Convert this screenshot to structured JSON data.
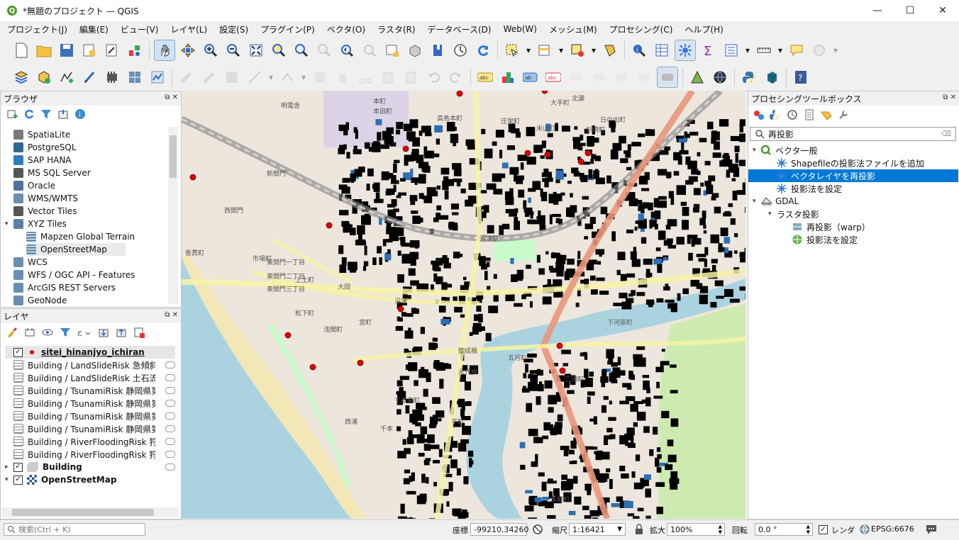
{
  "window": {
    "title": "*無題のプロジェクト — QGIS",
    "app_letter": "Q"
  },
  "menu": [
    "プロジェクト(J)",
    "編集(E)",
    "ビュー(V)",
    "レイヤ(L)",
    "設定(S)",
    "プラグイン(P)",
    "ベクタ(O)",
    "ラスタ(R)",
    "データベース(D)",
    "Web(W)",
    "メッシュ(M)",
    "プロセシング(C)",
    "ヘルプ(H)"
  ],
  "browser": {
    "title": "ブラウザ",
    "items": [
      {
        "label": "SpatiaLite",
        "icon": "spatialite-icon",
        "color": "#7a7a7a",
        "level": 0
      },
      {
        "label": "PostgreSQL",
        "icon": "postgresql-icon",
        "color": "#336791",
        "level": 0
      },
      {
        "label": "SAP HANA",
        "icon": "sap-hana-icon",
        "color": "#2b7bbf",
        "level": 0
      },
      {
        "label": "MS SQL Server",
        "icon": "mssql-icon",
        "color": "#555555",
        "level": 0
      },
      {
        "label": "Oracle",
        "icon": "oracle-icon",
        "color": "#4f6f9f",
        "level": 0
      },
      {
        "label": "WMS/WMTS",
        "icon": "wms-icon",
        "color": "#6a8fb3",
        "level": 0
      },
      {
        "label": "Vector Tiles",
        "icon": "vector-tiles-icon",
        "color": "#555555",
        "level": 0
      },
      {
        "label": "XYZ Tiles",
        "icon": "xyz-tiles-icon",
        "color": "#5b7fa5",
        "level": 0
      },
      {
        "label": "Mapzen Global Terrain",
        "icon": "grid-icon",
        "color": "#6a8fb3",
        "level": 1
      },
      {
        "label": "OpenStreetMap",
        "icon": "grid-icon",
        "color": "#6a8fb3",
        "level": 1
      },
      {
        "label": "WCS",
        "icon": "wcs-icon",
        "color": "#6a8fb3",
        "level": 0
      },
      {
        "label": "WFS / OGC API - Features",
        "icon": "wfs-icon",
        "color": "#6a8fb3",
        "level": 0
      },
      {
        "label": "ArcGIS REST Servers",
        "icon": "arcgis-icon",
        "color": "#6a8fb3",
        "level": 0
      },
      {
        "label": "GeoNode",
        "icon": "geonode-icon",
        "color": "#6a8fb3",
        "level": 0
      }
    ]
  },
  "layers": {
    "title": "レイヤ",
    "items": [
      {
        "label": "sitei_hinanjyo_ichiran",
        "checked": true,
        "icon": "point-layer-icon",
        "bold": true,
        "underline": true
      },
      {
        "label": "Building / LandSlideRisk 急傾斜地",
        "checked": null,
        "icon": "table-icon"
      },
      {
        "label": "Building / LandSlideRisk 土石流",
        "checked": null,
        "icon": "table-icon"
      },
      {
        "label": "Building / TsunamiRisk 静岡県第４",
        "checked": null,
        "icon": "table-icon"
      },
      {
        "label": "Building / TsunamiRisk 静岡県第４",
        "checked": null,
        "icon": "table-icon"
      },
      {
        "label": "Building / TsunamiRisk 静岡県第４",
        "checked": null,
        "icon": "table-icon"
      },
      {
        "label": "Building / TsunamiRisk 静岡県第４",
        "checked": null,
        "icon": "table-icon"
      },
      {
        "label": "Building / RiverFloodingRisk 狩野川",
        "checked": null,
        "icon": "table-icon"
      },
      {
        "label": "Building / RiverFloodingRisk 狩野川",
        "checked": null,
        "icon": "table-icon"
      },
      {
        "label": "Building",
        "checked": true,
        "icon": "polygon-layer-icon",
        "bold": true
      },
      {
        "label": "OpenStreetMap",
        "checked": true,
        "icon": "raster-layer-icon",
        "bold": true
      }
    ]
  },
  "toolbox": {
    "title": "プロセシングツールボックス",
    "search_value": "再投影",
    "items": [
      {
        "label": "ベクタ一般",
        "level": 0,
        "icon": "qgis-logo-icon",
        "expanded": true
      },
      {
        "label": "Shapefileの投影法ファイルを追加",
        "level": 1,
        "icon": "gear-icon"
      },
      {
        "label": "ベクタレイヤを再投影",
        "level": 1,
        "icon": "gear-icon",
        "selected": true
      },
      {
        "label": "投影法を設定",
        "level": 1,
        "icon": "gear-icon"
      },
      {
        "label": "GDAL",
        "level": 0,
        "icon": "gdal-icon",
        "expanded": true
      },
      {
        "label": "ラスタ投影",
        "level": 1,
        "icon": "",
        "expanded": true
      },
      {
        "label": "再投影（warp）",
        "level": 2,
        "icon": "warp-icon"
      },
      {
        "label": "投影法を設定",
        "level": 2,
        "icon": "assign-projection-icon"
      }
    ]
  },
  "statusbar": {
    "search_placeholder": "検索(Ctrl + K)",
    "coord_label": "座標",
    "coord_value": "-99210,34260",
    "scale_label": "縮尺",
    "scale_value": "1:16421",
    "magnifier_label": "拡大",
    "magnifier_value": "100%",
    "rotation_label": "回転",
    "rotation_value": "0.0 °",
    "render_label": "レンダ",
    "crs_value": "EPSG:6676"
  },
  "map_labels": [
    "本町",
    "明電舎",
    "本田町",
    "高島本町",
    "庄栄町",
    "米山町",
    "杉崎町",
    "日の出町",
    "北瀬",
    "西間門",
    "新間門",
    "香貫町",
    "市場町",
    "大岡",
    "沼津",
    "西浦",
    "千本",
    "東間門一丁目",
    "東間門二丁目",
    "東間門三丁目",
    "松下町",
    "宮町",
    "浅間町",
    "千本東町",
    "三田町",
    "下河原町",
    "五月町",
    "平町",
    "本郷町",
    "上土町",
    "御成橋",
    "永代橋",
    "大手町",
    "沼津駅"
  ],
  "colors": {
    "selection": "#0078d7",
    "water": "#aad3df",
    "park": "#c8facc",
    "road_major": "#f7f3a6",
    "road_primary": "#e9967a",
    "building": "#000000",
    "shelter": "#e00000"
  }
}
